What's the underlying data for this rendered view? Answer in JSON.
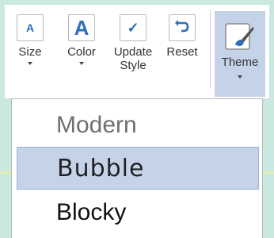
{
  "toolbar": {
    "buttons": [
      {
        "key": "size",
        "icon": "font-size-icon",
        "glyph": "A",
        "label": "Size",
        "has_dropdown": true
      },
      {
        "key": "color",
        "icon": "font-color-icon",
        "glyph": "A",
        "label": "Color",
        "has_dropdown": true
      },
      {
        "key": "update_style",
        "icon": "checkmark-icon",
        "glyph": "✓",
        "label": "Update\nStyle",
        "has_dropdown": false
      },
      {
        "key": "reset",
        "icon": "reset-arrow-icon",
        "glyph": "↺",
        "label": "Reset",
        "has_dropdown": false
      }
    ],
    "theme": {
      "icon": "theme-brush-icon",
      "label": "Theme",
      "active": true
    }
  },
  "theme_menu": {
    "items": [
      {
        "label": "Modern",
        "selected": false
      },
      {
        "label": "Bubble",
        "selected": true
      },
      {
        "label": "Blocky",
        "selected": false
      }
    ]
  },
  "colors": {
    "background": "#c9e8df",
    "accent_blue": "#2e6db8",
    "selected_bg": "#c4d3e8"
  }
}
